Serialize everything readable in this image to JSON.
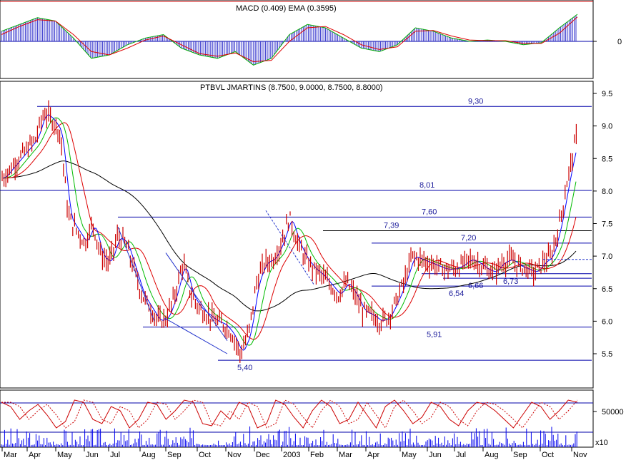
{
  "macd_title": "MACD (0.409) EMA (0.3595)",
  "price_title": "PTBVL JMARTINS (8.7500, 9.0000, 8.7500, 8.8000)",
  "colors": {
    "bars": "#cc0000",
    "levels": "#0000aa",
    "trendline": "#2233cc",
    "ma_blue": "#0000ff",
    "ma_green": "#00bb00",
    "ma_red": "#dd0000",
    "ma_black": "#000000",
    "histogram": "#3333cc"
  },
  "chart_data": [
    {
      "type": "line",
      "panel": "macd",
      "title": "MACD (0.409) EMA (0.3595)",
      "y_tick_labels": [
        "0"
      ],
      "series": [
        {
          "values": [
            0.15,
            0.25,
            0.35,
            0.3,
            0.05,
            -0.25,
            -0.2,
            -0.05,
            0.05,
            0.1,
            -0.1,
            -0.2,
            -0.25,
            -0.15,
            -0.35,
            -0.25,
            0.1,
            0.25,
            0.2,
            0.05,
            -0.1,
            -0.15,
            -0.05,
            0.2,
            0.15,
            0.05,
            0.0,
            0.02,
            0.0,
            -0.05,
            -0.02,
            0.2,
            0.4
          ]
        },
        {
          "values": [
            0.1,
            0.22,
            0.32,
            0.3,
            0.1,
            -0.15,
            -0.2,
            -0.1,
            0.02,
            0.08,
            -0.05,
            -0.18,
            -0.22,
            -0.17,
            -0.3,
            -0.28,
            0.0,
            0.2,
            0.22,
            0.1,
            -0.05,
            -0.12,
            -0.08,
            0.15,
            0.16,
            0.08,
            0.02,
            0.01,
            0.01,
            -0.03,
            -0.03,
            0.12,
            0.36
          ]
        }
      ],
      "histogram": [
        0.15,
        0.25,
        0.35,
        0.3,
        0.05,
        -0.25,
        -0.2,
        -0.05,
        0.05,
        0.1,
        -0.1,
        -0.2,
        -0.25,
        -0.15,
        -0.35,
        -0.25,
        0.1,
        0.25,
        0.2,
        0.05,
        -0.1,
        -0.15,
        -0.05,
        0.2,
        0.15,
        0.05,
        0.0,
        0.02,
        0.0,
        -0.05,
        -0.02,
        0.2,
        0.4
      ]
    },
    {
      "type": "candlestick",
      "panel": "price",
      "title": "PTBVL JMARTINS (8.7500, 9.0000, 8.7500, 8.8000)",
      "x_tick_labels": [
        "Mar",
        "Apr",
        "May",
        "Jun",
        "Jul",
        "Aug",
        "Sep",
        "Oct",
        "Nov",
        "Dec",
        "2003",
        "Feb",
        "Mar",
        "Apr",
        "May",
        "Jun",
        "Jul",
        "Aug",
        "Sep",
        "Oct",
        "Nov"
      ],
      "y_tick_labels": [
        "9.5",
        "9.0",
        "8.5",
        "8.0",
        "7.5",
        "7.0",
        "6.5",
        "6.0",
        "5.5"
      ],
      "ylim": [
        5.2,
        9.6
      ],
      "close_path": [
        [
          0,
          8.2
        ],
        [
          2,
          8.5
        ],
        [
          4,
          8.8
        ],
        [
          5,
          9.2
        ],
        [
          6,
          9.1
        ],
        [
          7,
          8.9
        ],
        [
          8,
          7.6
        ],
        [
          9,
          7.4
        ],
        [
          10,
          7.2
        ],
        [
          11,
          7.5
        ],
        [
          12,
          7.0
        ],
        [
          13,
          6.9
        ],
        [
          14,
          7.3
        ],
        [
          15,
          7.2
        ],
        [
          16,
          6.8
        ],
        [
          17,
          6.4
        ],
        [
          18,
          6.2
        ],
        [
          19,
          6.0
        ],
        [
          20,
          6.05
        ],
        [
          21,
          6.4
        ],
        [
          22,
          6.9
        ],
        [
          23,
          6.4
        ],
        [
          24,
          6.2
        ],
        [
          25,
          6.1
        ],
        [
          26,
          6.0
        ],
        [
          27,
          5.95
        ],
        [
          28,
          5.8
        ],
        [
          29,
          5.5
        ],
        [
          30,
          5.8
        ],
        [
          31,
          6.6
        ],
        [
          32,
          6.9
        ],
        [
          33,
          6.95
        ],
        [
          34,
          7.2
        ],
        [
          35,
          7.6
        ],
        [
          36,
          7.2
        ],
        [
          37,
          6.95
        ],
        [
          38,
          6.8
        ],
        [
          39,
          6.7
        ],
        [
          40,
          6.55
        ],
        [
          41,
          6.4
        ],
        [
          42,
          6.6
        ],
        [
          43,
          6.4
        ],
        [
          44,
          6.15
        ],
        [
          45,
          6.1
        ],
        [
          46,
          6.0
        ],
        [
          47,
          6.05
        ],
        [
          48,
          6.3
        ],
        [
          49,
          6.6
        ],
        [
          50,
          7.0
        ],
        [
          51,
          6.95
        ],
        [
          52,
          6.9
        ],
        [
          53,
          6.85
        ],
        [
          54,
          6.8
        ],
        [
          55,
          6.8
        ],
        [
          56,
          6.85
        ],
        [
          57,
          6.95
        ],
        [
          58,
          6.9
        ],
        [
          59,
          6.8
        ],
        [
          60,
          6.75
        ],
        [
          61,
          6.9
        ],
        [
          62,
          6.95
        ],
        [
          63,
          6.85
        ],
        [
          64,
          6.8
        ],
        [
          65,
          6.75
        ],
        [
          66,
          6.9
        ],
        [
          67,
          7.0
        ],
        [
          68,
          7.5
        ],
        [
          69,
          8.2
        ],
        [
          70,
          8.8
        ]
      ],
      "levels": [
        {
          "label": "9,30",
          "value": 9.3
        },
        {
          "label": "8,01",
          "value": 8.01
        },
        {
          "label": "7,60",
          "value": 7.6
        },
        {
          "label": "7,39",
          "value": 7.39
        },
        {
          "label": "7,20",
          "value": 7.2
        },
        {
          "label": "6,73",
          "value": 6.73
        },
        {
          "label": "6,66",
          "value": 6.66
        },
        {
          "label": "6,54",
          "value": 6.54
        },
        {
          "label": "5,91",
          "value": 5.91
        },
        {
          "label": "5,40",
          "value": 5.4
        }
      ]
    },
    {
      "type": "bar",
      "panel": "volume",
      "y_tick_labels": [
        "50000"
      ],
      "scale_label": "x10",
      "stochastic": [
        80,
        70,
        40,
        60,
        75,
        50,
        20,
        35,
        85,
        80,
        40,
        30,
        70,
        60,
        20,
        40,
        80,
        75,
        40,
        60,
        85,
        80,
        30,
        25,
        60,
        40,
        80,
        70,
        20,
        30,
        85,
        75,
        45,
        20,
        60,
        85,
        70,
        30,
        40,
        80,
        50,
        20,
        70,
        85,
        60,
        30,
        45,
        80,
        70,
        40,
        25,
        60,
        80,
        75,
        60,
        40,
        20,
        50,
        80,
        70,
        40,
        60,
        85,
        80
      ]
    }
  ]
}
